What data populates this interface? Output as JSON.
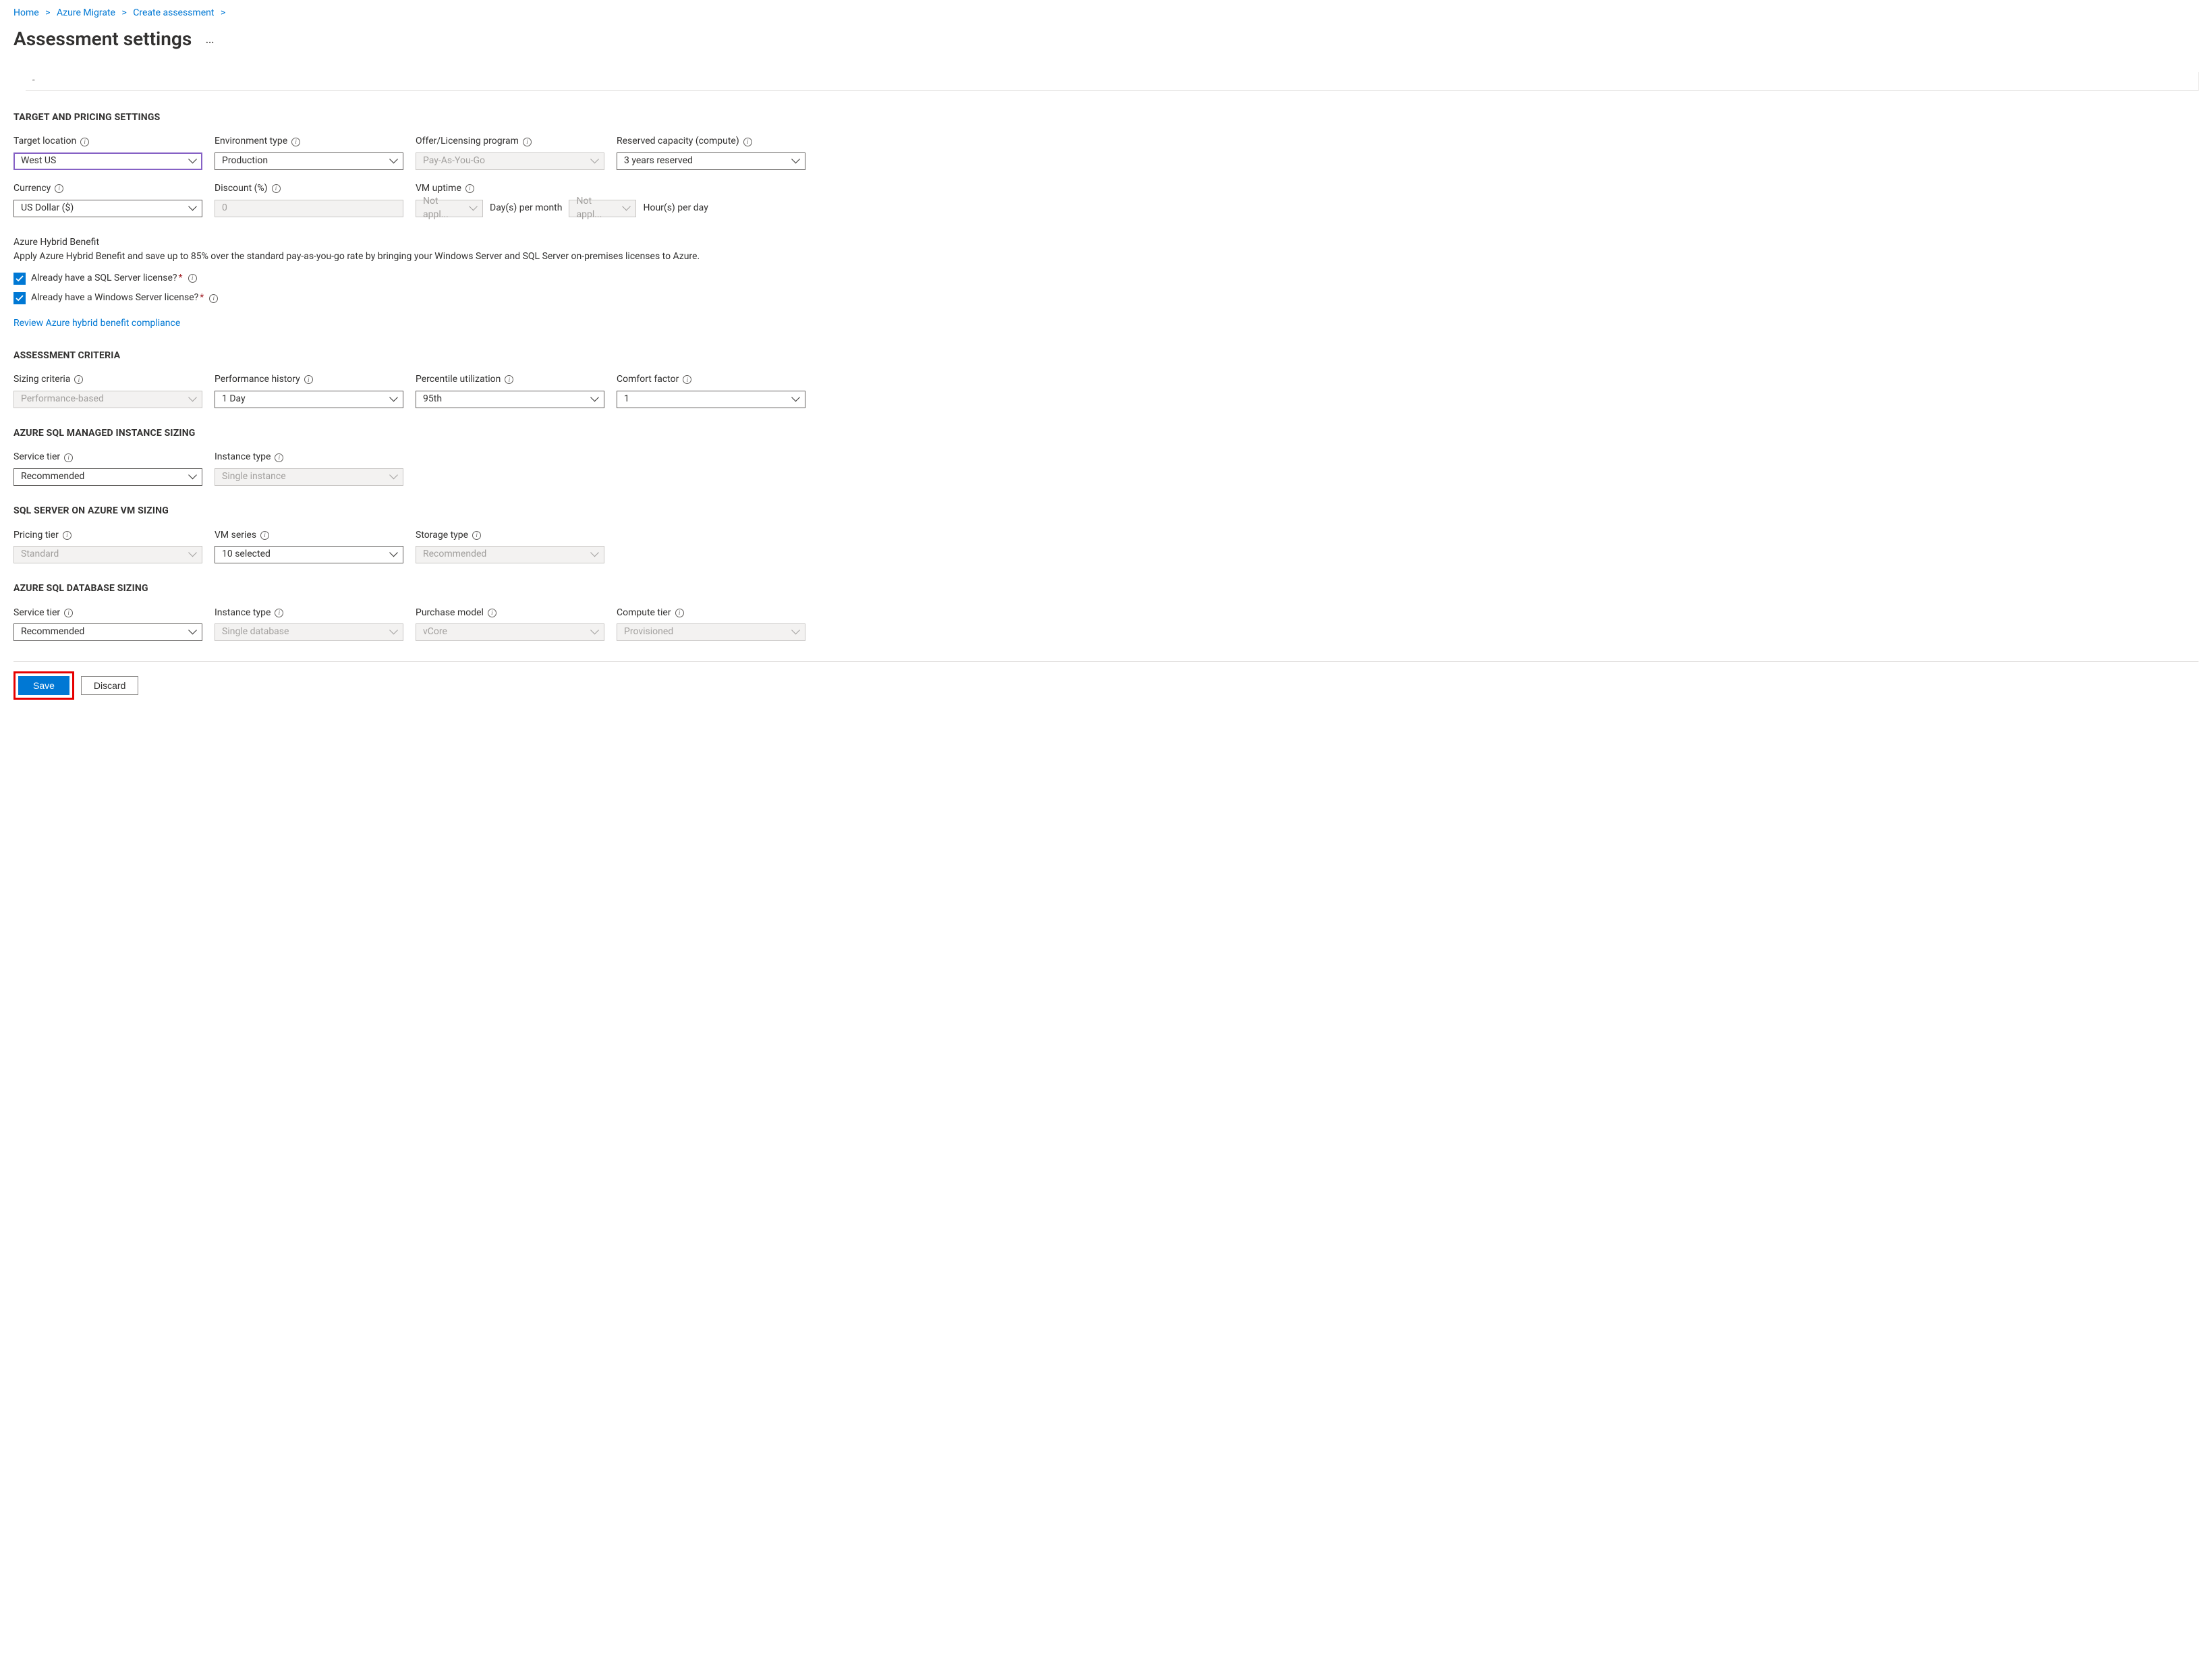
{
  "breadcrumb": {
    "home": "Home",
    "azure_migrate": "Azure Migrate",
    "create_assessment": "Create assessment"
  },
  "page_title": "Assessment settings",
  "sections": {
    "target_pricing": "TARGET AND PRICING SETTINGS",
    "assessment_criteria": "ASSESSMENT CRITERIA",
    "sql_mi_sizing": "AZURE SQL MANAGED INSTANCE SIZING",
    "sql_vm_sizing": "SQL SERVER ON AZURE VM SIZING",
    "sql_db_sizing": "AZURE SQL DATABASE SIZING"
  },
  "fields": {
    "target_location": {
      "label": "Target location",
      "value": "West US"
    },
    "environment_type": {
      "label": "Environment type",
      "value": "Production"
    },
    "offer_program": {
      "label": "Offer/Licensing program",
      "value": "Pay-As-You-Go"
    },
    "reserved_capacity": {
      "label": "Reserved capacity (compute)",
      "value": "3 years reserved"
    },
    "currency": {
      "label": "Currency",
      "value": "US Dollar ($)"
    },
    "discount": {
      "label": "Discount (%)",
      "value": "0"
    },
    "vm_uptime": {
      "label": "VM uptime",
      "days_value": "Not appl...",
      "days_unit": "Day(s) per month",
      "hours_value": "Not appl...",
      "hours_unit": "Hour(s) per day"
    },
    "sizing_criteria": {
      "label": "Sizing criteria",
      "value": "Performance-based"
    },
    "performance_history": {
      "label": "Performance history",
      "value": "1 Day"
    },
    "percentile_utilization": {
      "label": "Percentile utilization",
      "value": "95th"
    },
    "comfort_factor": {
      "label": "Comfort factor",
      "value": "1"
    },
    "mi_service_tier": {
      "label": "Service tier",
      "value": "Recommended"
    },
    "mi_instance_type": {
      "label": "Instance type",
      "value": "Single instance"
    },
    "vm_pricing_tier": {
      "label": "Pricing tier",
      "value": "Standard"
    },
    "vm_series": {
      "label": "VM series",
      "value": "10 selected"
    },
    "vm_storage_type": {
      "label": "Storage type",
      "value": "Recommended"
    },
    "db_service_tier": {
      "label": "Service tier",
      "value": "Recommended"
    },
    "db_instance_type": {
      "label": "Instance type",
      "value": "Single database"
    },
    "db_purchase_model": {
      "label": "Purchase model",
      "value": "vCore"
    },
    "db_compute_tier": {
      "label": "Compute tier",
      "value": "Provisioned"
    }
  },
  "hybrid": {
    "title": "Azure Hybrid Benefit",
    "desc": "Apply Azure Hybrid Benefit and save up to 85% over the standard pay-as-you-go rate by bringing your Windows Server and SQL Server on-premises licenses to Azure.",
    "checkbox_sql": "Already have a SQL Server license?",
    "checkbox_win": "Already have a Windows Server license?",
    "compliance_link": "Review Azure hybrid benefit compliance"
  },
  "buttons": {
    "save": "Save",
    "discard": "Discard"
  }
}
